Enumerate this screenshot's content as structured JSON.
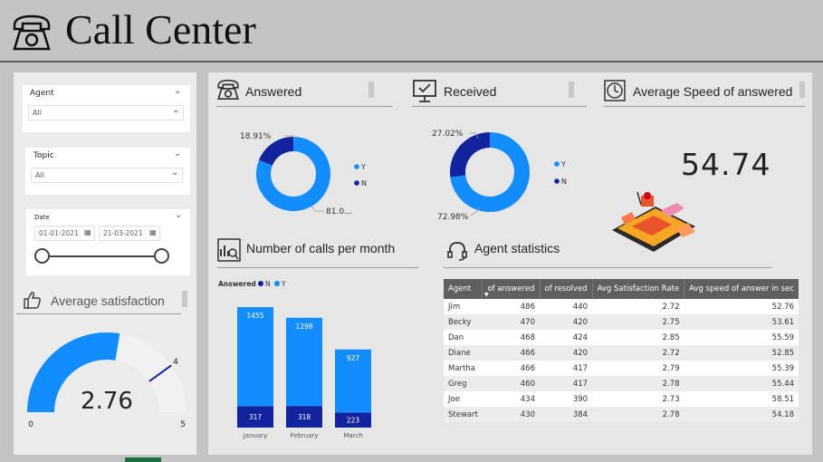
{
  "header": {
    "title": "Call Center",
    "icon": "telephone-icon"
  },
  "filters": {
    "agent": {
      "label": "Agent",
      "value": "All"
    },
    "topic": {
      "label": "Topic",
      "value": "All"
    },
    "date": {
      "label": "Date",
      "start": "01-01-2021",
      "end": "21-03-2021"
    }
  },
  "satisfaction": {
    "title": "Average satisfaction",
    "value": "2.76",
    "min": "0",
    "max": "5",
    "target": "4",
    "fraction": 0.552,
    "target_fraction": 0.8
  },
  "answered": {
    "title": "Answered",
    "label_n": "18.91%",
    "label_y": "81.0...",
    "legend_y": "Y",
    "legend_n": "N",
    "fraction_n": 0.1891
  },
  "received": {
    "title": "Received",
    "label_n": "27.02%",
    "label_y": "72.98%",
    "legend_y": "Y",
    "legend_n": "N",
    "fraction_n": 0.2702
  },
  "speed": {
    "title": "Average Speed of answered",
    "value": "54.74"
  },
  "calls_chart": {
    "title": "Number of calls per month",
    "legend_title": "Answered",
    "legend_n": "N",
    "legend_y": "Y"
  },
  "chart_data": {
    "type": "bar",
    "stacked": true,
    "categories": [
      "January",
      "February",
      "March"
    ],
    "series": [
      {
        "name": "N",
        "values": [
          317,
          318,
          223
        ]
      },
      {
        "name": "Y",
        "values": [
          1455,
          1298,
          927
        ]
      }
    ],
    "legend_title": "Answered",
    "colors": {
      "N": "#12239e",
      "Y": "#118dff"
    }
  },
  "agent_stats": {
    "title": "Agent statistics",
    "columns": [
      "Agent",
      "of answered",
      "of resolved",
      "Avg Satisfaction Rate",
      "Avg speed of answer in sec"
    ],
    "rows": [
      [
        "Jim",
        "486",
        "440",
        "2.72",
        "52.76"
      ],
      [
        "Becky",
        "470",
        "420",
        "2.75",
        "53.61"
      ],
      [
        "Dan",
        "468",
        "424",
        "2.85",
        "55.59"
      ],
      [
        "Diane",
        "466",
        "420",
        "2.72",
        "52.85"
      ],
      [
        "Martha",
        "466",
        "417",
        "2.79",
        "55.39"
      ],
      [
        "Greg",
        "460",
        "417",
        "2.78",
        "55.44"
      ],
      [
        "Joe",
        "434",
        "390",
        "2.73",
        "58.51"
      ],
      [
        "Stewart",
        "430",
        "384",
        "2.78",
        "54.18"
      ]
    ]
  },
  "colors": {
    "accent_y": "#118dff",
    "accent_n": "#12239e"
  }
}
